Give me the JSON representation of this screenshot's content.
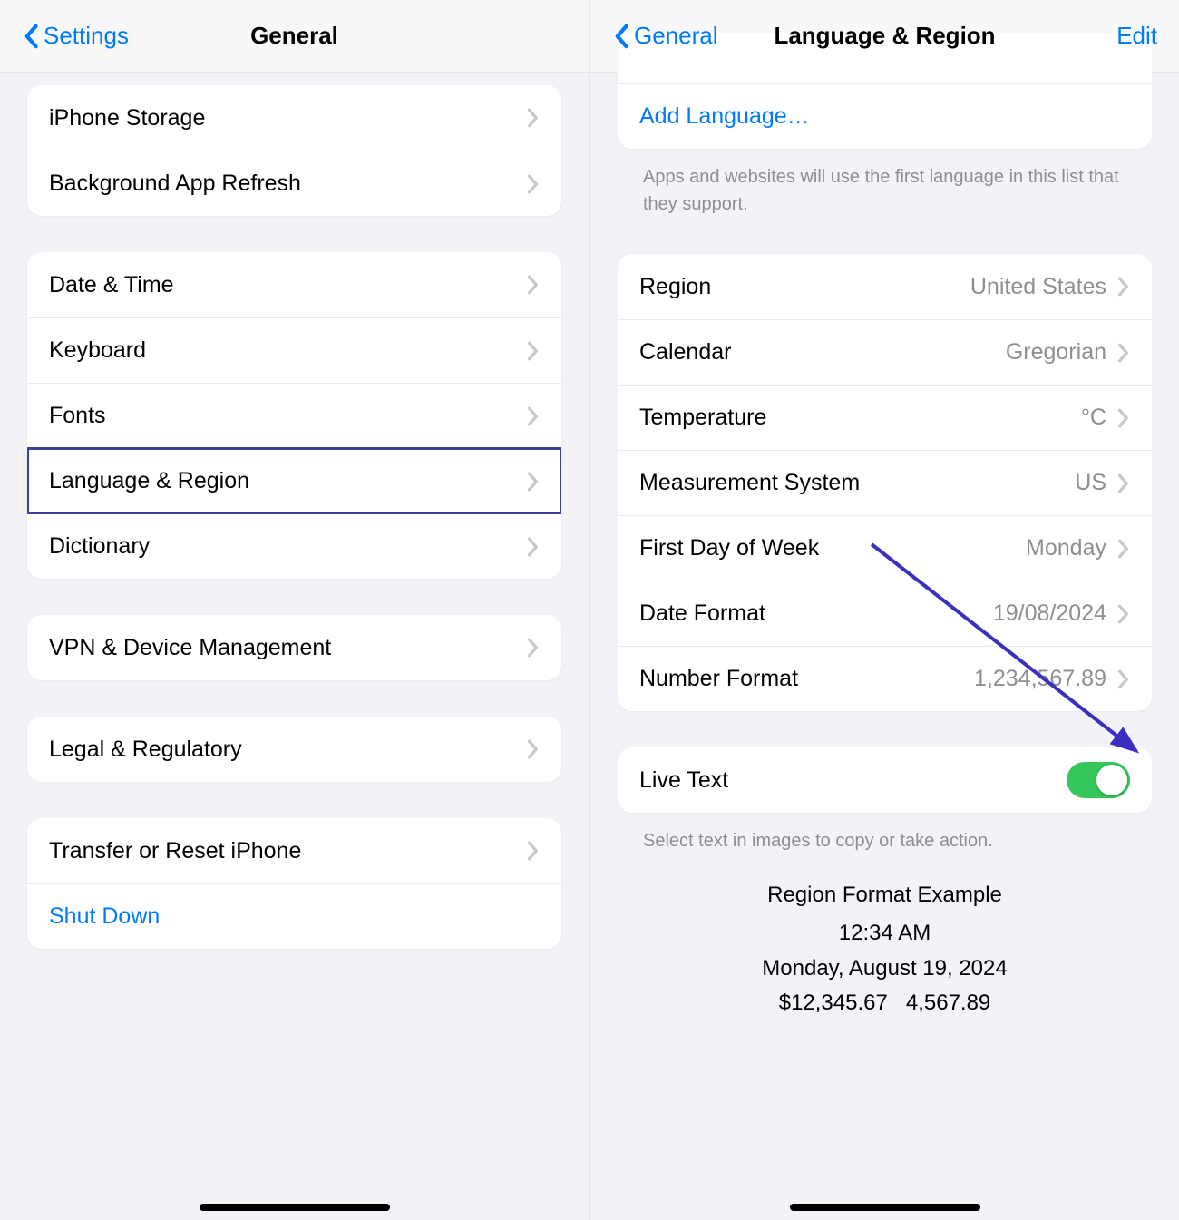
{
  "left": {
    "back_label": "Settings",
    "title": "General",
    "groups": [
      {
        "rows": [
          {
            "label": "iPhone Storage",
            "id": "iphone-storage"
          },
          {
            "label": "Background App Refresh",
            "id": "background-app-refresh"
          }
        ]
      },
      {
        "rows": [
          {
            "label": "Date & Time",
            "id": "date-time"
          },
          {
            "label": "Keyboard",
            "id": "keyboard"
          },
          {
            "label": "Fonts",
            "id": "fonts"
          },
          {
            "label": "Language & Region",
            "id": "language-region",
            "highlighted": true
          },
          {
            "label": "Dictionary",
            "id": "dictionary"
          }
        ]
      },
      {
        "rows": [
          {
            "label": "VPN & Device Management",
            "id": "vpn-device-management"
          }
        ]
      },
      {
        "rows": [
          {
            "label": "Legal & Regulatory",
            "id": "legal-regulatory"
          }
        ]
      },
      {
        "rows": [
          {
            "label": "Transfer or Reset iPhone",
            "id": "transfer-reset"
          },
          {
            "label": "Shut Down",
            "id": "shut-down",
            "link": true,
            "no_chevron": true
          }
        ]
      }
    ]
  },
  "right": {
    "back_label": "General",
    "title": "Language & Region",
    "edit_label": "Edit",
    "add_language_label": "Add Language…",
    "lang_footer": "Apps and websites will use the first language in this list that they support.",
    "region_rows": [
      {
        "label": "Region",
        "value": "United States",
        "id": "region"
      },
      {
        "label": "Calendar",
        "value": "Gregorian",
        "id": "calendar"
      },
      {
        "label": "Temperature",
        "value": "°C",
        "id": "temperature"
      },
      {
        "label": "Measurement System",
        "value": "US",
        "id": "measurement-system"
      },
      {
        "label": "First Day of Week",
        "value": "Monday",
        "id": "first-day-of-week"
      },
      {
        "label": "Date Format",
        "value": "19/08/2024",
        "id": "date-format"
      },
      {
        "label": "Number Format",
        "value": "1,234,567.89",
        "id": "number-format"
      }
    ],
    "live_text_label": "Live Text",
    "live_text_footer": "Select text in images to copy or take action.",
    "example_title": "Region Format Example",
    "example_time": "12:34 AM",
    "example_date": "Monday, August 19, 2024",
    "example_currency": "$12,345.67",
    "example_number": "4,567.89"
  }
}
